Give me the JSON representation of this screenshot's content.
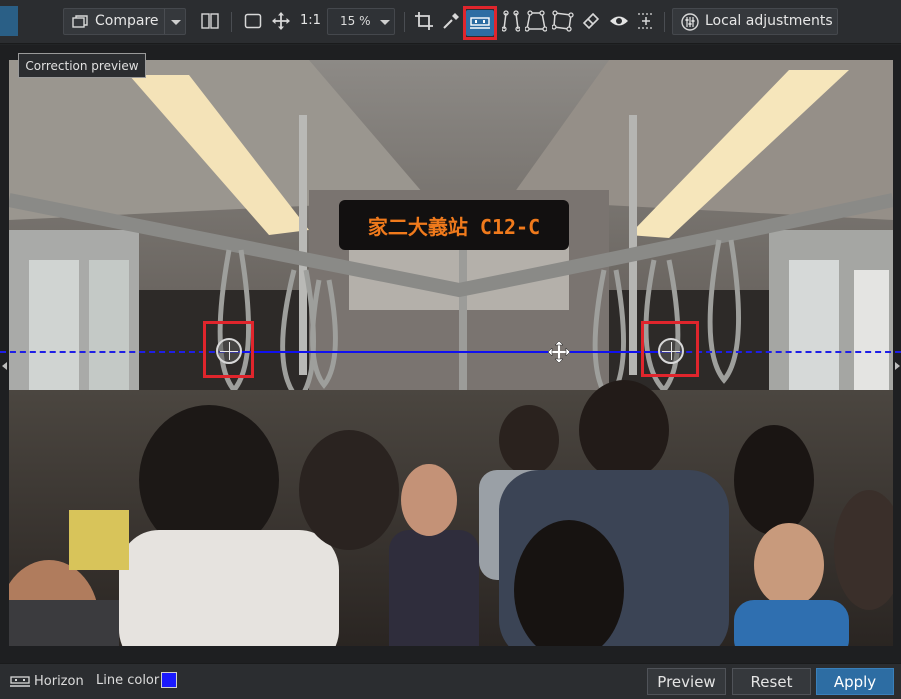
{
  "toolbar": {
    "compare_label": "Compare",
    "zoom_1to1": "1:1",
    "zoom_value": "15 %",
    "local_adjustments_label": "Local adjustments",
    "icons": [
      "compare-window-icon",
      "split-view-icon",
      "fit-icon",
      "pan-icon",
      "crop-icon",
      "eyedropper-icon",
      "horizon-tool-icon",
      "perspective-vertical-icon",
      "perspective-rect-icon",
      "perspective-8pt-icon",
      "eraser-icon",
      "eye-icon",
      "grid-icon",
      "local-adjustments-icon"
    ]
  },
  "tooltip": {
    "text": "Correction preview"
  },
  "photo": {
    "sign_text": "家二大義站 C12-C"
  },
  "bottombar": {
    "horizon_label": "Horizon",
    "line_color_label": "Line color",
    "line_color": "#1a1aff",
    "preview_label": "Preview",
    "reset_label": "Reset",
    "apply_label": "Apply"
  },
  "colors": {
    "accent": "#2d6da3",
    "highlight": "#e0252c",
    "horizon_line": "#1010f0"
  }
}
